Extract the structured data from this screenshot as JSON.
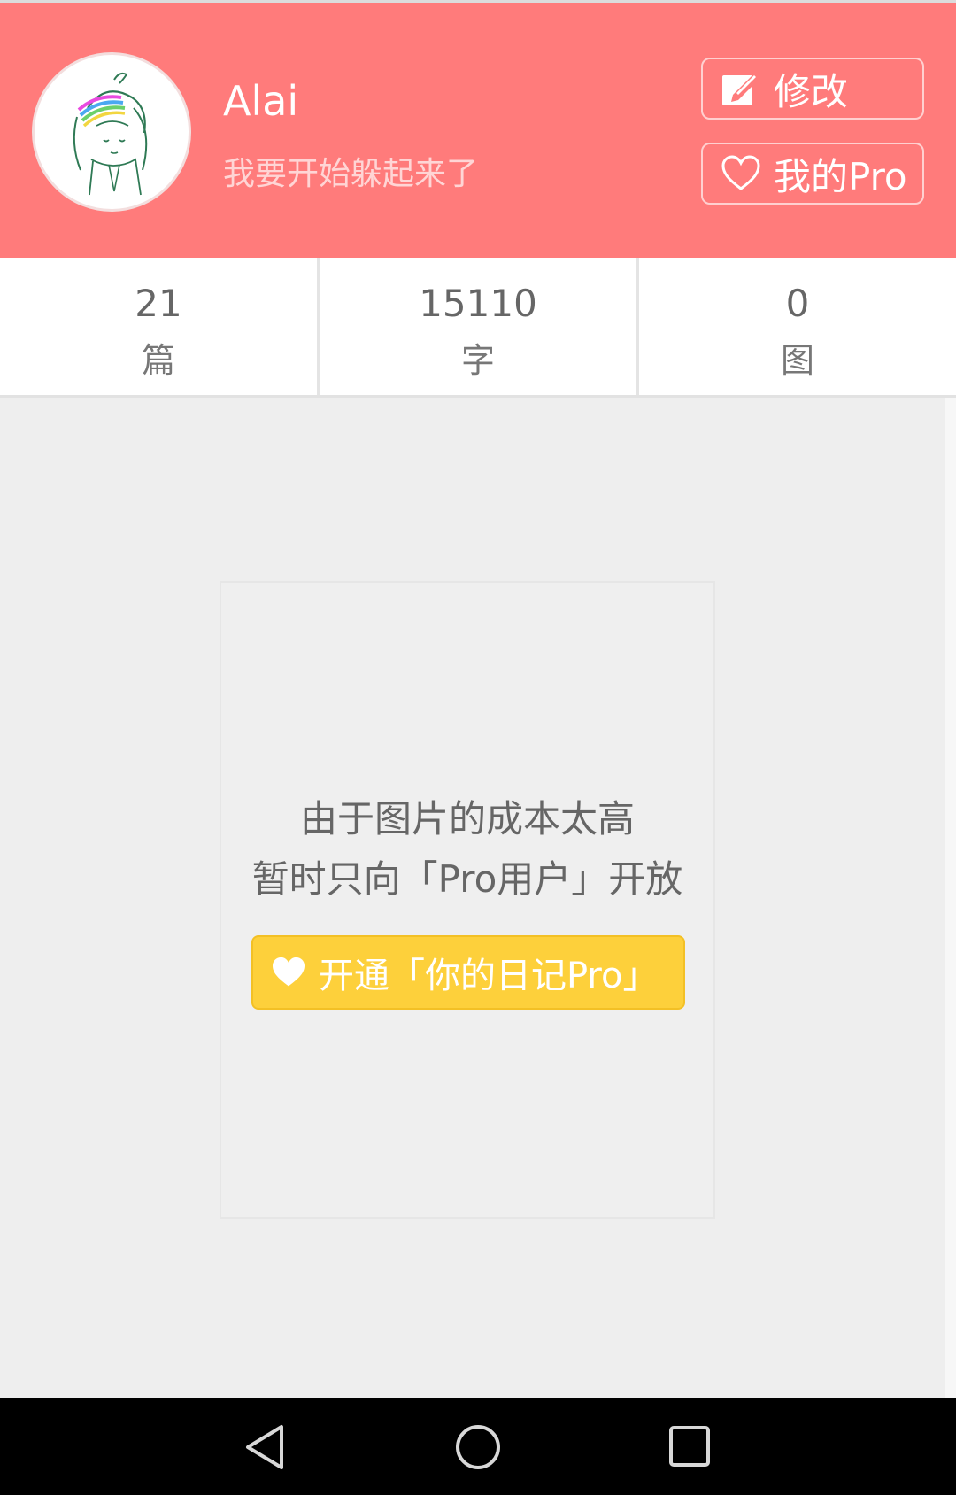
{
  "profile": {
    "name": "Alai",
    "bio": "我要开始躲起来了",
    "avatar_icon": "avatar-sketch"
  },
  "header": {
    "background": "#ff7b7b",
    "edit_button": {
      "label": "修改",
      "icon": "edit-icon"
    },
    "pro_button": {
      "label": "我的Pro",
      "icon": "heart-outline-icon"
    }
  },
  "stats": [
    {
      "value": "21",
      "label": "篇"
    },
    {
      "value": "15110",
      "label": "字"
    },
    {
      "value": "0",
      "label": "图"
    }
  ],
  "photos_locked": {
    "line1": "由于图片的成本太高",
    "line2": "暂时只向「Pro用户」开放",
    "cta_label": "开通「你的日记Pro」",
    "cta_icon": "heart-icon",
    "cta_color": "#fdd03b"
  },
  "navbar": {
    "back_icon": "back-triangle-icon",
    "home_icon": "home-circle-icon",
    "recents_icon": "recents-square-icon"
  }
}
